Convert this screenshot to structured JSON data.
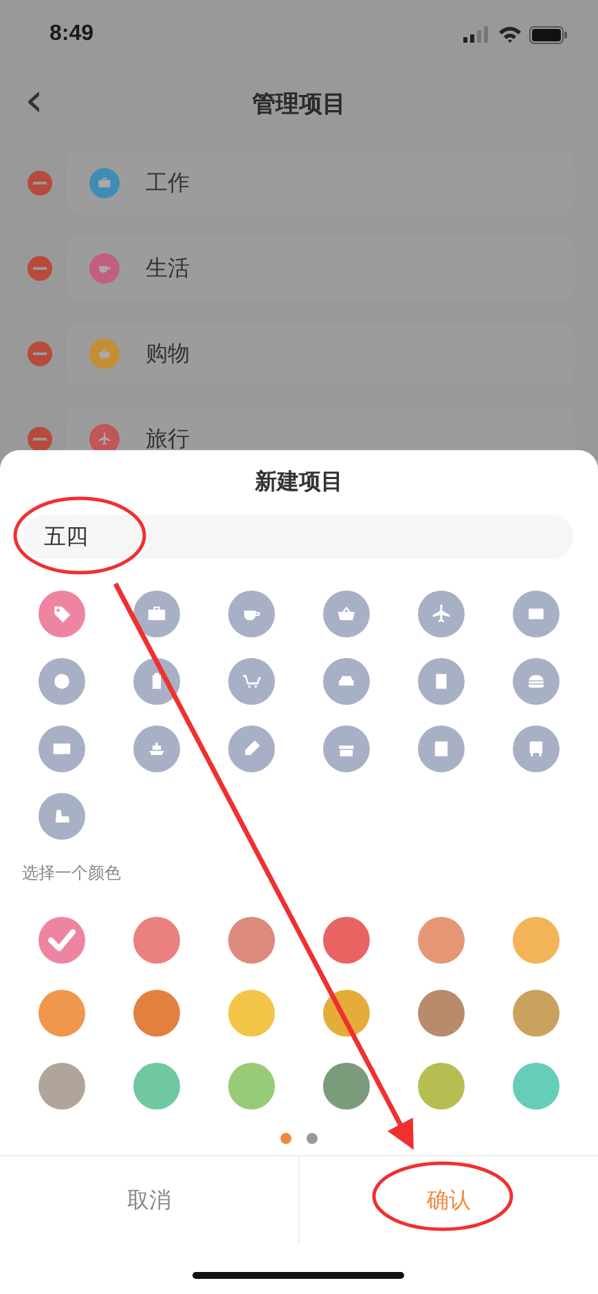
{
  "status_bar": {
    "time": "8:49"
  },
  "nav": {
    "back": "‹",
    "title": "管理项目"
  },
  "categories": [
    {
      "name": "工作",
      "kind": "briefcase",
      "color": "#3f8cb5"
    },
    {
      "name": "生活",
      "kind": "cup",
      "color": "#c0607e"
    },
    {
      "name": "购物",
      "kind": "basket",
      "color": "#c48e33"
    },
    {
      "name": "旅行",
      "kind": "plane",
      "color": "#c05656"
    }
  ],
  "sheet": {
    "title": "新建项目",
    "name_field": {
      "value": "五四"
    },
    "icons": [
      {
        "kind": "tag",
        "selected": true
      },
      {
        "kind": "briefcase",
        "selected": false
      },
      {
        "kind": "cup",
        "selected": false
      },
      {
        "kind": "basket",
        "selected": false
      },
      {
        "kind": "plane",
        "selected": false
      },
      {
        "kind": "mail",
        "selected": false
      },
      {
        "kind": "yen",
        "selected": false
      },
      {
        "kind": "luggage",
        "selected": false
      },
      {
        "kind": "cart",
        "selected": false
      },
      {
        "kind": "car",
        "selected": false
      },
      {
        "kind": "book",
        "selected": false
      },
      {
        "kind": "burger",
        "selected": false
      },
      {
        "kind": "card",
        "selected": false
      },
      {
        "kind": "ship",
        "selected": false
      },
      {
        "kind": "pencil",
        "selected": false
      },
      {
        "kind": "gift",
        "selected": false
      },
      {
        "kind": "calculator",
        "selected": false
      },
      {
        "kind": "bus",
        "selected": false
      },
      {
        "kind": "arm",
        "selected": false
      }
    ],
    "color_label": "选择一个颜色",
    "colors": [
      {
        "color": "#ee85a0",
        "selected": true
      },
      {
        "color": "#ea8080",
        "selected": false
      },
      {
        "color": "#dc8a7c",
        "selected": false
      },
      {
        "color": "#e86462",
        "selected": false
      },
      {
        "color": "#e49675",
        "selected": false
      },
      {
        "color": "#f3b358",
        "selected": false
      },
      {
        "color": "#ef974d",
        "selected": false
      },
      {
        "color": "#e2803f",
        "selected": false
      },
      {
        "color": "#f2c448",
        "selected": false
      },
      {
        "color": "#e6ac3a",
        "selected": false
      },
      {
        "color": "#b98b6c",
        "selected": false
      },
      {
        "color": "#c9a25e",
        "selected": false
      },
      {
        "color": "#b0a598",
        "selected": false
      },
      {
        "color": "#6fc8a0",
        "selected": false
      },
      {
        "color": "#98cb75",
        "selected": false
      },
      {
        "color": "#7a9c7b",
        "selected": false
      },
      {
        "color": "#b6be52",
        "selected": false
      },
      {
        "color": "#66cdb9",
        "selected": false
      }
    ],
    "pages": [
      {
        "selected": true
      },
      {
        "selected": false
      }
    ],
    "cancel": "取消",
    "confirm": "确认"
  },
  "annotations": [
    {
      "kind": "ellipse"
    },
    {
      "kind": "ellipse"
    },
    {
      "kind": "arrow"
    }
  ]
}
